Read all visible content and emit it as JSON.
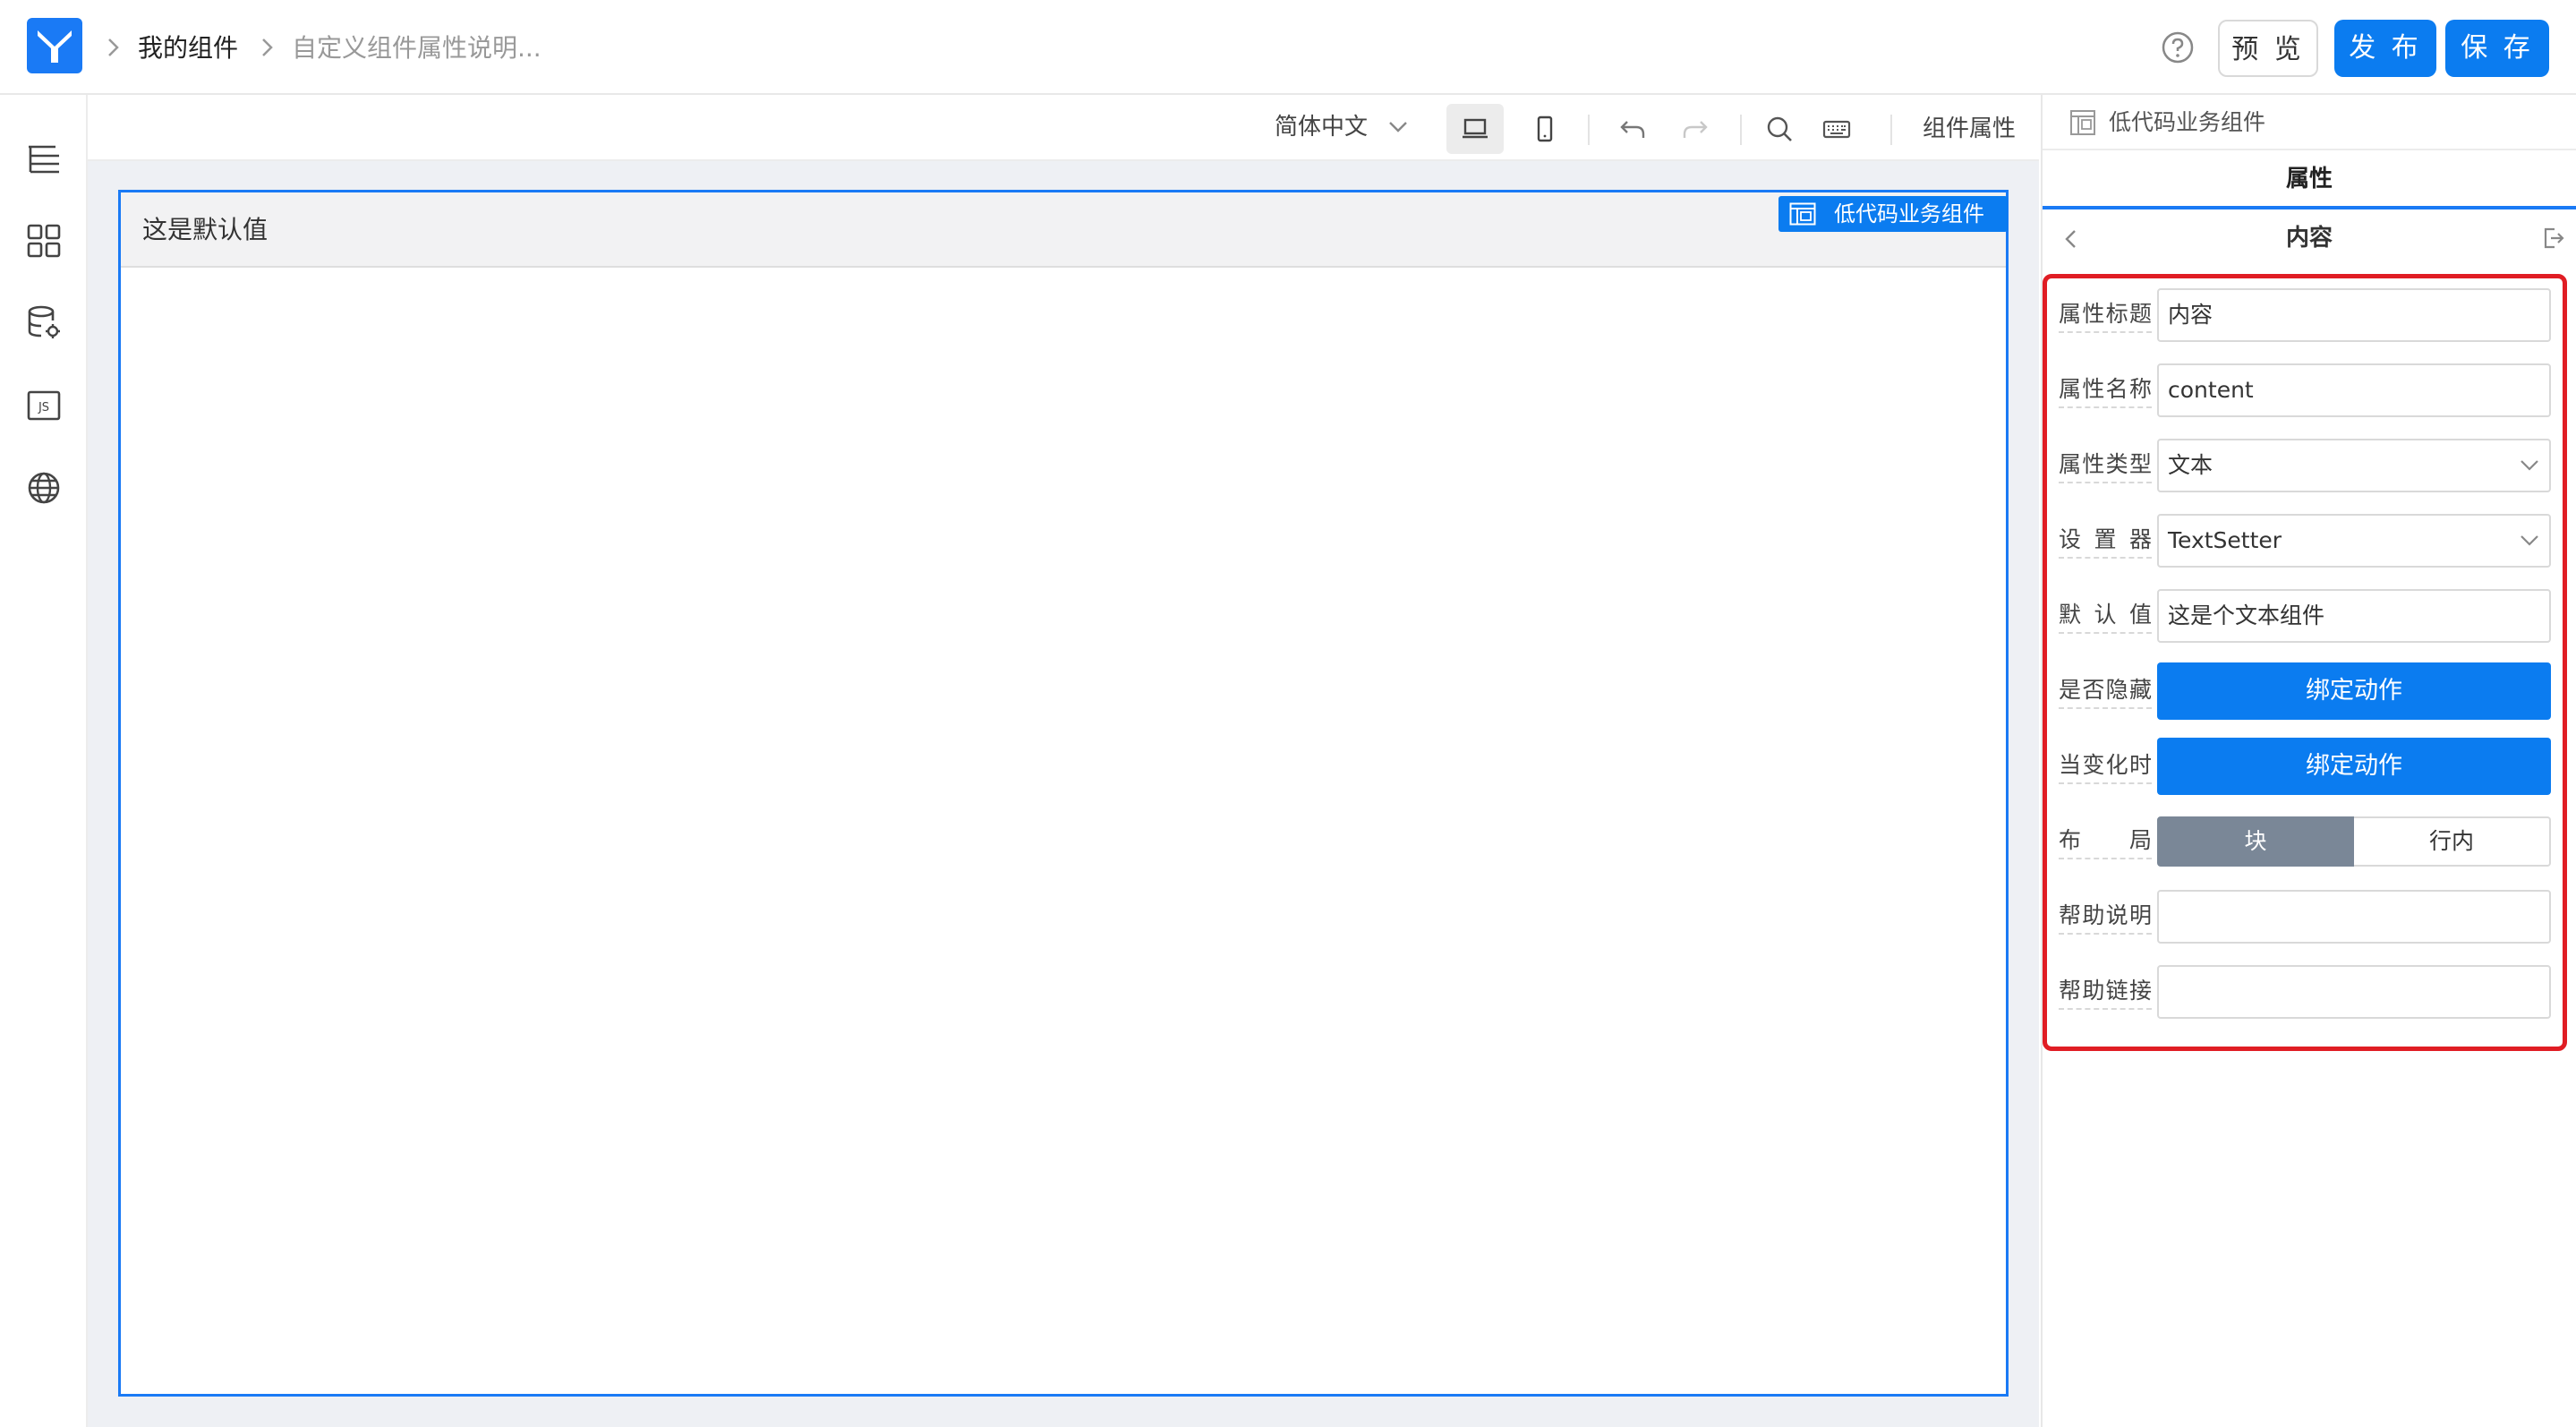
{
  "header": {
    "breadcrumb": [
      "我的组件",
      "自定义组件属性说明..."
    ],
    "buttons": {
      "preview": "预 览",
      "publish": "发 布",
      "save": "保 存"
    }
  },
  "toolbar": {
    "language": "简体中文",
    "component_props_label": "组件属性"
  },
  "canvas": {
    "component_value": "这是默认值",
    "component_tag": "低代码业务组件"
  },
  "right_panel": {
    "header_title": "低代码业务组件",
    "tab": "属性",
    "section_title": "内容",
    "fields": {
      "title": {
        "label": "属性标题",
        "value": "内容"
      },
      "name": {
        "label": "属性名称",
        "value": "content"
      },
      "type": {
        "label": "属性类型",
        "value": "文本"
      },
      "setter": {
        "label": "设 置 器",
        "value": "TextSetter"
      },
      "default": {
        "label": "默 认 值",
        "value": "这是个文本组件"
      },
      "hidden": {
        "label": "是否隐藏",
        "button": "绑定动作"
      },
      "on_change": {
        "label": "当变化时",
        "button": "绑定动作"
      },
      "layout": {
        "label": "布 局",
        "options": [
          "块",
          "行内"
        ],
        "selected": "块"
      },
      "help_text": {
        "label": "帮助说明",
        "value": ""
      },
      "help_link": {
        "label": "帮助链接",
        "value": ""
      }
    }
  },
  "colors": {
    "accent": "#0b7cf0",
    "highlight": "#e01d24",
    "segment_selected": "#7a8797"
  }
}
